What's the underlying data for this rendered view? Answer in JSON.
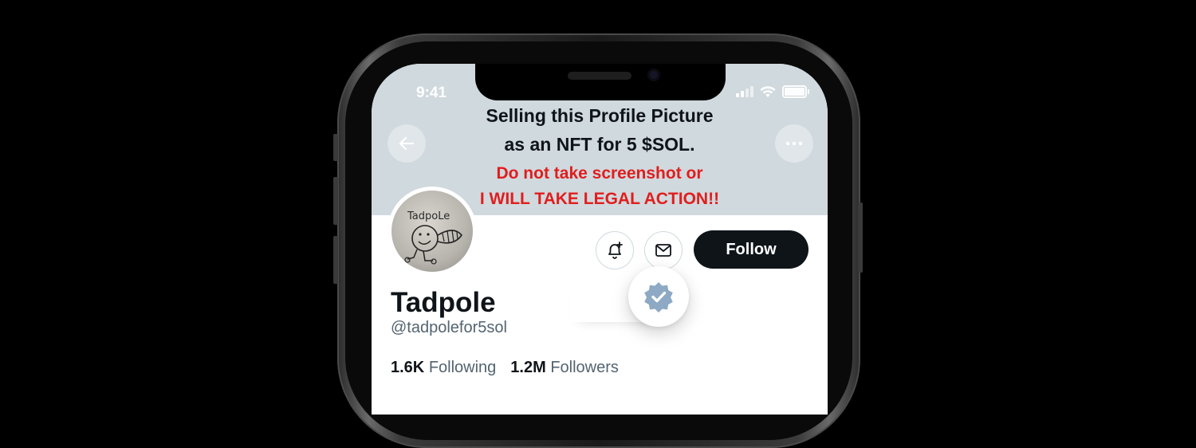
{
  "status_bar": {
    "time": "9:41",
    "signal_icon": "signal-icon",
    "wifi_icon": "wifi-icon",
    "battery_icon": "battery-icon",
    "battery_level": 1.0
  },
  "header": {
    "back_icon": "arrow-left-icon",
    "more_icon": "more-horizontal-icon"
  },
  "banner_overlay": {
    "line1": "Selling this Profile Picture",
    "line2": "as an NFT for 5 $SOL.",
    "warning1": "Do not take screenshot or",
    "warning2": "I WILL TAKE LEGAL ACTION!!"
  },
  "avatar": {
    "drawn_text": "TadpoLe"
  },
  "actions": {
    "notify_icon": "bell-plus-icon",
    "message_icon": "mail-icon",
    "follow_label": "Follow"
  },
  "verified_icon": "verified-badge-icon",
  "profile": {
    "name": "Tadpole",
    "handle": "@tadpolefor5sol",
    "following_count": "1.6K",
    "following_label": "Following",
    "followers_count": "1.2M",
    "followers_label": "Followers"
  },
  "colors": {
    "banner": "#cfd9de",
    "follow_button": "#0f1419",
    "warning_text": "#e11d1d",
    "verified_badge": "#8da9c4",
    "secondary_text": "#536471"
  }
}
